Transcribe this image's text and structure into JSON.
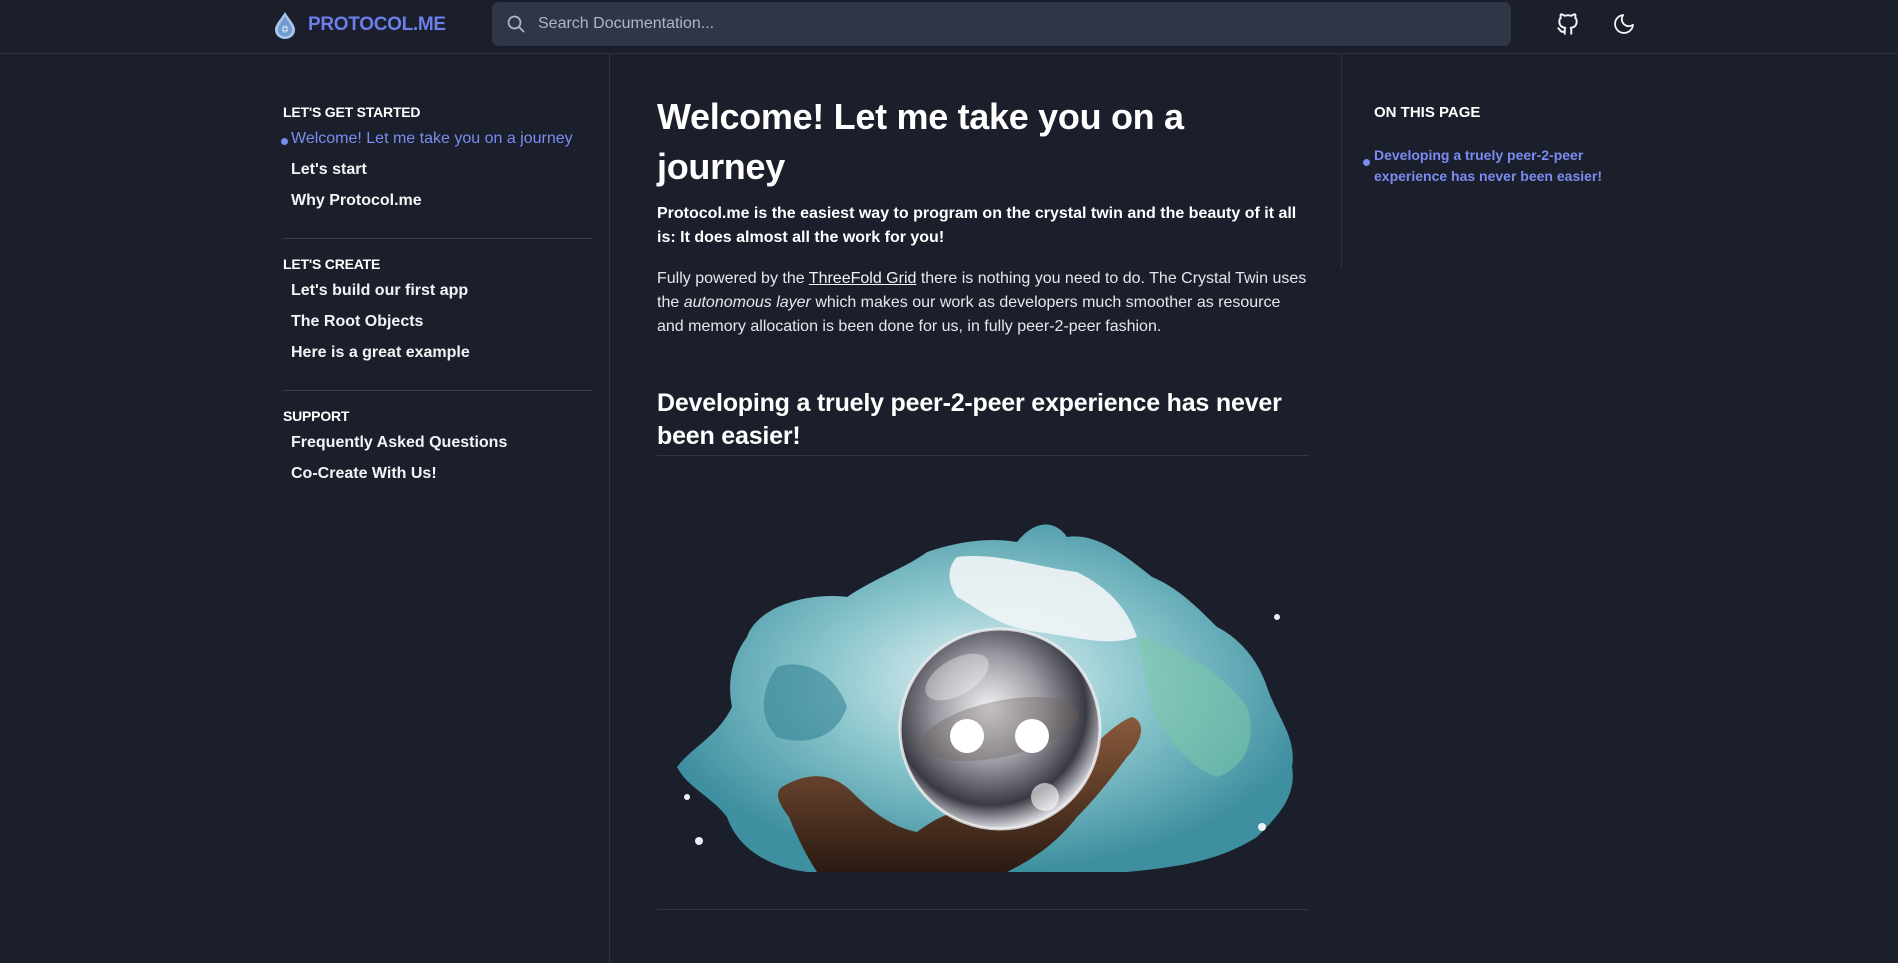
{
  "header": {
    "logo_text": "PROTOCOL.ME",
    "search_placeholder": "Search Documentation...",
    "github_icon": "github-icon",
    "theme_icon": "moon-icon"
  },
  "sidebar": {
    "sections": [
      {
        "title": "LET'S GET STARTED",
        "items": [
          {
            "label": "Welcome! Let me take you on a journey",
            "active": true
          },
          {
            "label": "Let's start"
          },
          {
            "label": "Why Protocol.me"
          }
        ]
      },
      {
        "title": "LET'S CREATE",
        "items": [
          {
            "label": "Let's build our first app"
          },
          {
            "label": "The Root Objects"
          },
          {
            "label": "Here is a great example"
          }
        ]
      },
      {
        "title": "SUPPORT",
        "items": [
          {
            "label": "Frequently Asked Questions"
          },
          {
            "label": "Co-Create With Us!"
          }
        ]
      }
    ]
  },
  "main": {
    "title": "Welcome! Let me take you on a journey",
    "lead": "Protocol.me is the easiest way to program on the crystal twin and the beauty of it all is: It does almost all the work for you!",
    "para": {
      "before_link": "Fully powered by the ",
      "link": "ThreeFold Grid",
      "after_link": " there is nothing you need to do. The Crystal Twin uses the ",
      "emphasis": "autonomous layer",
      "after_emphasis": " which makes our work as developers much smoother as resource and memory allocation is been done for us, in fully peer-2-peer fashion."
    },
    "h2": "Developing a truely peer-2-peer experience has never been easier!"
  },
  "toc": {
    "title": "ON THIS PAGE",
    "items": [
      {
        "label": "Developing a truely peer-2-peer experience has never been easier!",
        "active": true
      }
    ]
  },
  "colors": {
    "background": "#1a1f2b",
    "accent": "#7b8cf0",
    "search_bg": "#2f3747"
  }
}
